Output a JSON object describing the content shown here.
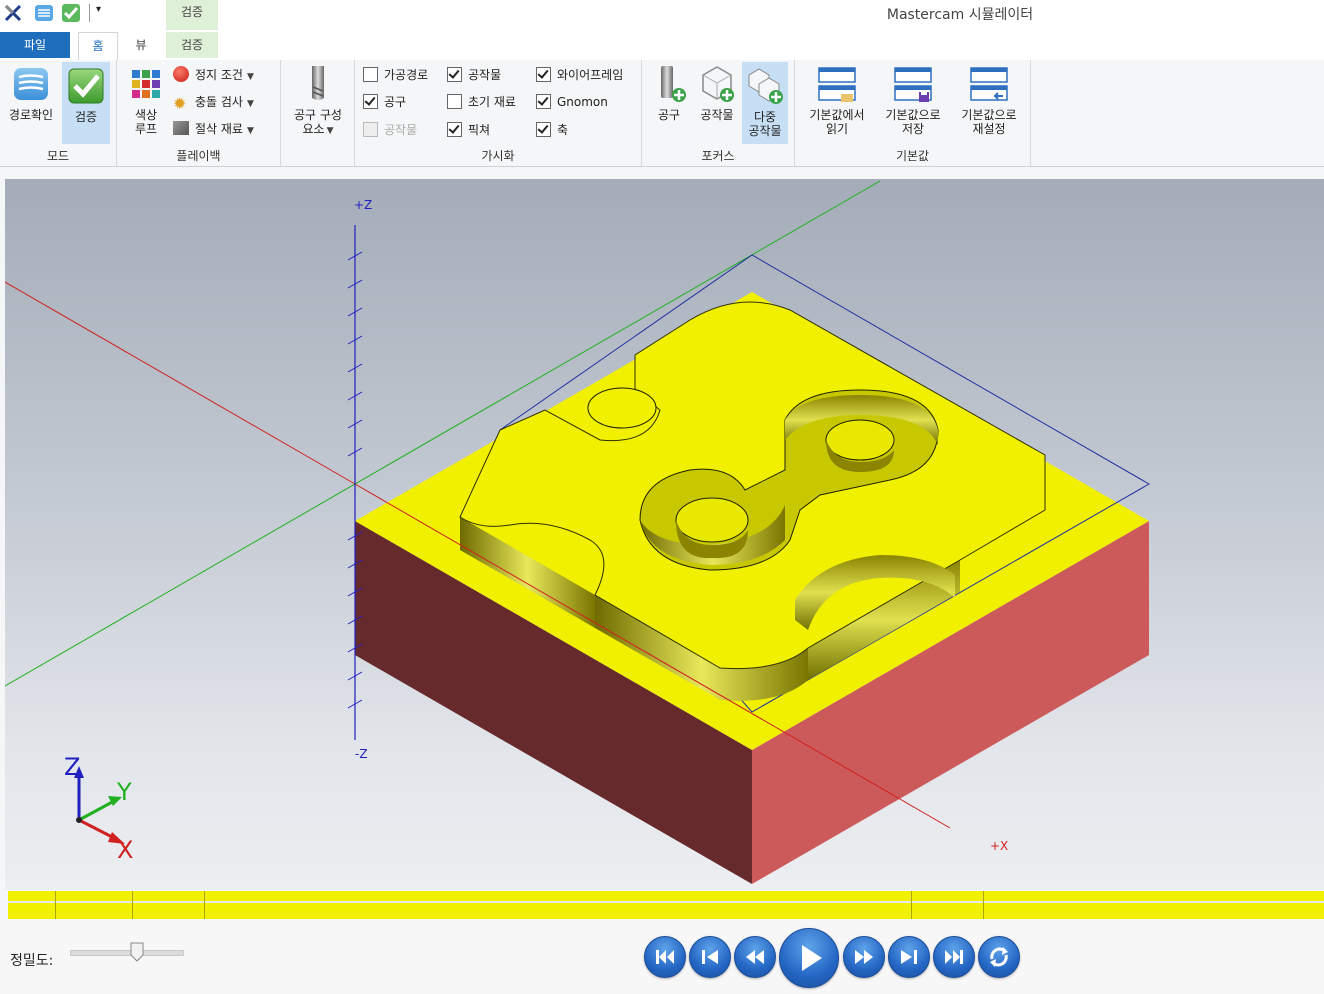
{
  "app": {
    "title": "Mastercam 시뮬레이터",
    "context_tab_group": "검증"
  },
  "tabs": {
    "file": "파일",
    "home": "홈",
    "view": "뷰",
    "verify": "검증"
  },
  "ribbon": {
    "mode": {
      "label": "모드",
      "backplot": "경로확인",
      "verify": "검증"
    },
    "playback": {
      "label": "플레이백",
      "color_loop": [
        "색상",
        "루프"
      ],
      "stop_conditions": "정지 조건",
      "collision_check": "충돌 검사",
      "cut_stock": "절삭 재료"
    },
    "tool_components": {
      "label": [
        "공구 구성",
        "요소"
      ]
    },
    "visibility": {
      "label": "가시화",
      "toolpath": {
        "text": "가공경로",
        "checked": false
      },
      "tool": {
        "text": "공구",
        "checked": true
      },
      "workpiece_disabled": {
        "text": "공작물",
        "checked": false
      },
      "workpiece": {
        "text": "공작물",
        "checked": true
      },
      "initial_stock": {
        "text": "초기 재료",
        "checked": false
      },
      "fixture": {
        "text": "픽쳐",
        "checked": true
      },
      "wireframe": {
        "text": "와이어프레임",
        "checked": true
      },
      "gnomon": {
        "text": "Gnomon",
        "checked": true
      },
      "axes": {
        "text": "축",
        "checked": true
      }
    },
    "focus": {
      "label": "포커스",
      "tool": "공구",
      "workpiece": "공작물",
      "multi_workpiece": [
        "다중",
        "공작물"
      ]
    },
    "defaults": {
      "label": "기본값",
      "load": [
        "기본값에서",
        "읽기"
      ],
      "save": [
        "기본값으로",
        "저장"
      ],
      "reset": [
        "기본값으로",
        "재설정"
      ]
    }
  },
  "viewport": {
    "axis_labels": {
      "plus_z": "+Z",
      "minus_z": "-Z",
      "plus_x": "+X"
    },
    "gnomon": {
      "z": "Z",
      "y": "Y",
      "x": "X"
    },
    "colors": {
      "stock_top": "#f0f000",
      "stock_left": "#662a2c",
      "stock_right": "#cd5a5a",
      "x_axis": "#cc2222",
      "y_axis": "#22aa22",
      "z_axis": "#2222cc"
    }
  },
  "bottom": {
    "precision_label": "정밀도:",
    "precision_level": 0.6
  },
  "playback_controls": [
    "go-to-start",
    "step-back",
    "rewind",
    "play",
    "fast-forward",
    "step-forward",
    "go-to-end",
    "loop"
  ]
}
